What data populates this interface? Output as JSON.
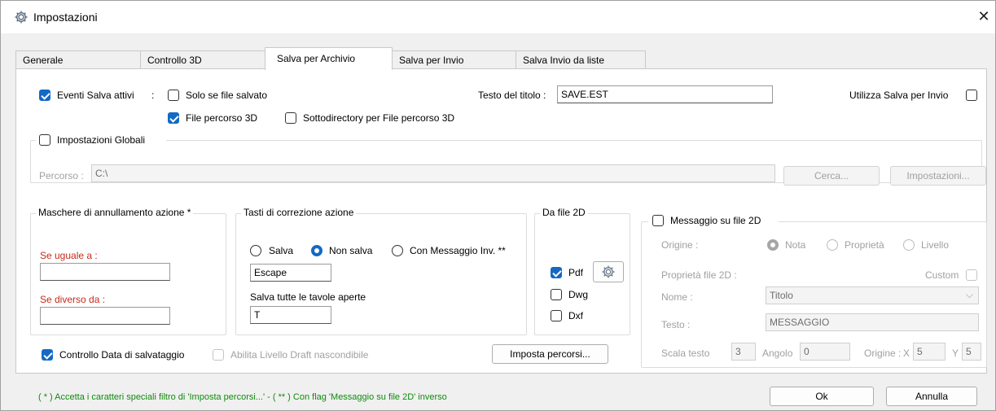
{
  "window": {
    "title": "Impostazioni",
    "icon": "gear-icon"
  },
  "tabs": [
    "Generale",
    "Controllo 3D",
    "Salva per Archivio",
    "Salva per Invio",
    "Salva Invio da liste"
  ],
  "top": {
    "eventi_salva_attivi": "Eventi Salva attivi",
    "colon": ":",
    "solo_se_file_salvato": "Solo se file salvato",
    "file_percorso_3d": "File percorso 3D",
    "sottodirectory": "Sottodirectory per File percorso 3D",
    "testo_titolo_label": "Testo del titolo :",
    "testo_titolo_value": "SAVE.EST",
    "utilizza_salva_invio": "Utilizza Salva per Invio"
  },
  "globali": {
    "label": "Impostazioni Globali",
    "percorso_label": "Percorso :",
    "percorso_value": "C:\\",
    "cerca_button": "Cerca...",
    "impostazioni_button": "Impostazioni..."
  },
  "maschere": {
    "title": "Maschere di annullamento azione *",
    "se_uguale": "Se uguale a :",
    "se_diverso": "Se diverso da :",
    "se_uguale_value": "",
    "se_diverso_value": ""
  },
  "tasti": {
    "title": "Tasti di correzione azione",
    "salva": "Salva",
    "non_salva": "Non salva",
    "con_messaggio": "Con Messaggio Inv. **",
    "tasto_value": "Escape",
    "salva_tutte": "Salva tutte le tavole aperte",
    "salva_tutte_value": "T"
  },
  "da_file_2d": {
    "title": "Da file 2D",
    "pdf": "Pdf",
    "dwg": "Dwg",
    "dxf": "Dxf"
  },
  "messaggio": {
    "title": "Messaggio su file 2D",
    "origine_label": "Origine :",
    "nota": "Nota",
    "proprieta": "Proprietà",
    "livello": "Livello",
    "proprieta_file": "Proprietà file 2D :",
    "custom": "Custom",
    "nome_label": "Nome :",
    "nome_value": "Titolo",
    "testo_label": "Testo :",
    "testo_value": "MESSAGGIO",
    "scala_label": "Scala testo",
    "scala_value": "3",
    "angolo_label": "Angolo",
    "angolo_value": "0",
    "origine_xy_label": "Origine :",
    "x_label": "X",
    "x_value": "5",
    "y_label": "Y",
    "y_value": "5"
  },
  "bottom": {
    "controllo_data": "Controllo Data di salvataggio",
    "abilita_draft": "Abilita Livello Draft nascondibile",
    "imposta_percorsi": "Imposta percorsi...",
    "footnote": "( * ) Accetta i caratteri speciali filtro di 'Imposta percorsi...' - ( ** ) Con flag 'Messaggio su file 2D' inverso",
    "ok": "Ok",
    "annulla": "Annulla"
  },
  "colors": {
    "accent": "#1469c4",
    "label_red": "#c42b1c",
    "footnote_green": "#118a0e"
  }
}
